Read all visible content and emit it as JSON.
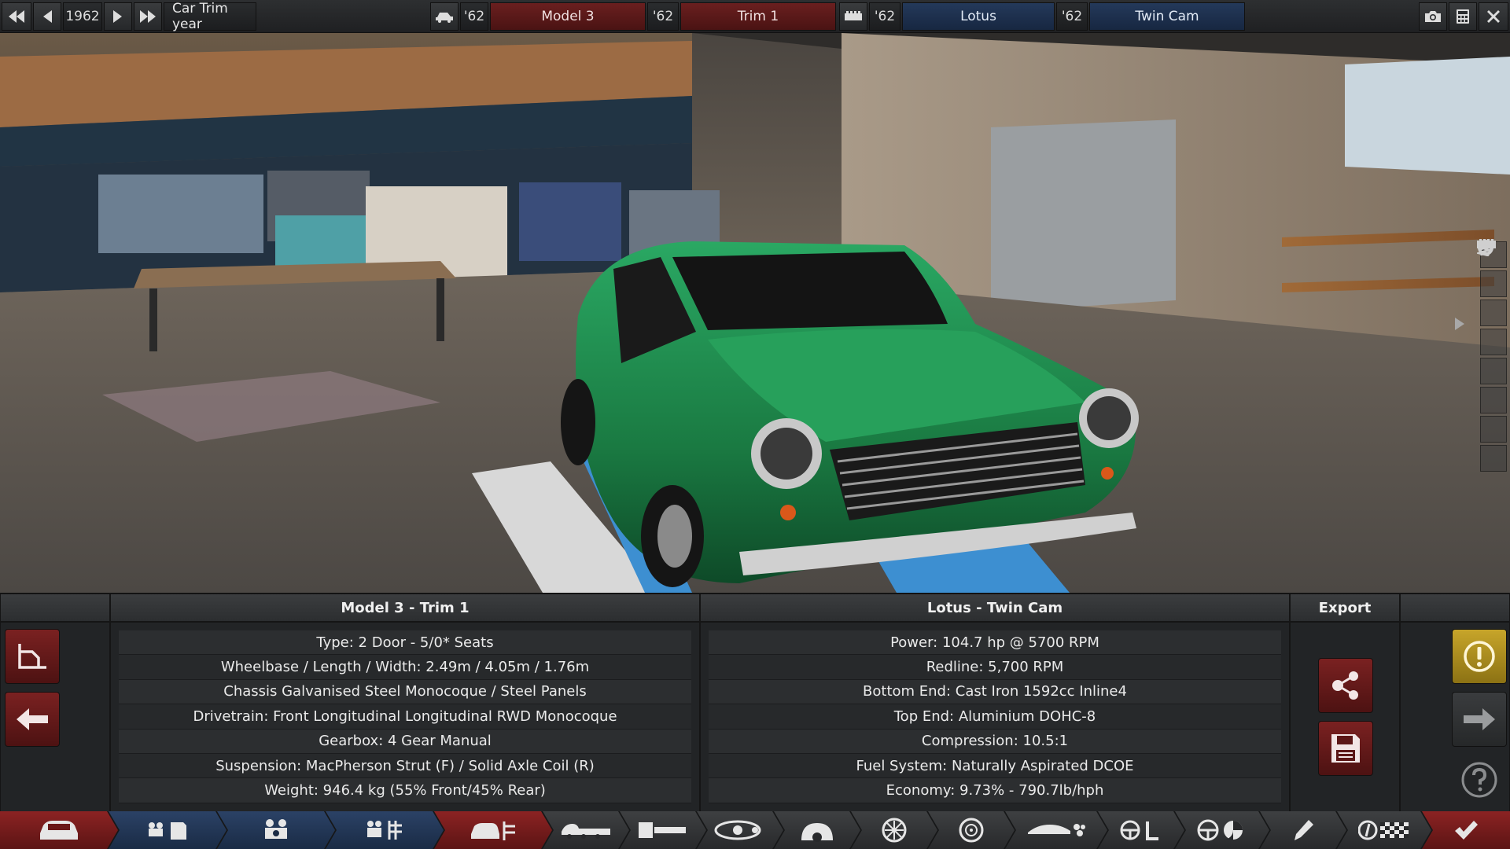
{
  "topbar": {
    "year": "1962",
    "year_label": "Car Trim year",
    "car_year": "'62",
    "model": "Model 3",
    "trim_year": "'62",
    "trim": "Trim 1",
    "engine_year": "'62",
    "engine_family": "Lotus",
    "variant_year": "'62",
    "variant": "Twin Cam"
  },
  "panel": {
    "car_header": "Model 3 - Trim 1",
    "engine_header": "Lotus - Twin Cam",
    "export_header": "Export",
    "car_stats": [
      "Type: 2 Door - 5/0* Seats",
      "Wheelbase / Length / Width: 2.49m / 4.05m / 1.76m",
      "Chassis Galvanised Steel Monocoque / Steel Panels",
      "Drivetrain: Front Longitudinal Longitudinal RWD Monocoque",
      "Gearbox: 4 Gear Manual",
      "Suspension: MacPherson Strut (F) / Solid Axle Coil (R)",
      "Weight: 946.4 kg (55% Front/45% Rear)"
    ],
    "engine_stats": [
      "Power: 104.7 hp @ 5700 RPM",
      "Redline: 5,700 RPM",
      "Bottom End: Cast Iron 1592cc Inline4",
      "Top End: Aluminium DOHC-8",
      "Compression: 10.5:1",
      "Fuel System: Naturally Aspirated DCOE",
      "Economy: 9.73% - 790.7lb/hph"
    ]
  },
  "colors": {
    "accent_red": "#7a2121",
    "accent_blue": "#24395a",
    "warning_gold": "#c7a52a",
    "car_green": "#1f8a4c"
  },
  "icons": {
    "topbar_left": [
      "skip-back-icon",
      "step-back-icon",
      "step-forward-icon",
      "skip-forward-icon"
    ],
    "topbar_right": [
      "camera-icon",
      "calculator-icon",
      "close-icon"
    ],
    "right_strip": [
      "driver-icon",
      "wheel-icon",
      "spring-icon",
      "axle-icon",
      "body-panel-icon",
      "car-profile-icon",
      "car-side-icon",
      "engine-block-icon"
    ],
    "tabs": [
      "car-body-icon",
      "engine-files-icon",
      "engine-icon",
      "engine-blueprint-icon",
      "car-trim-icon",
      "chassis-icon",
      "suspension-icon",
      "drivetrain-icon",
      "gearbox-icon",
      "wheels-icon",
      "brakes-icon",
      "aero-icon",
      "interior-icon",
      "safety-icon",
      "paint-icon",
      "testing-icon",
      "done-icon"
    ]
  }
}
